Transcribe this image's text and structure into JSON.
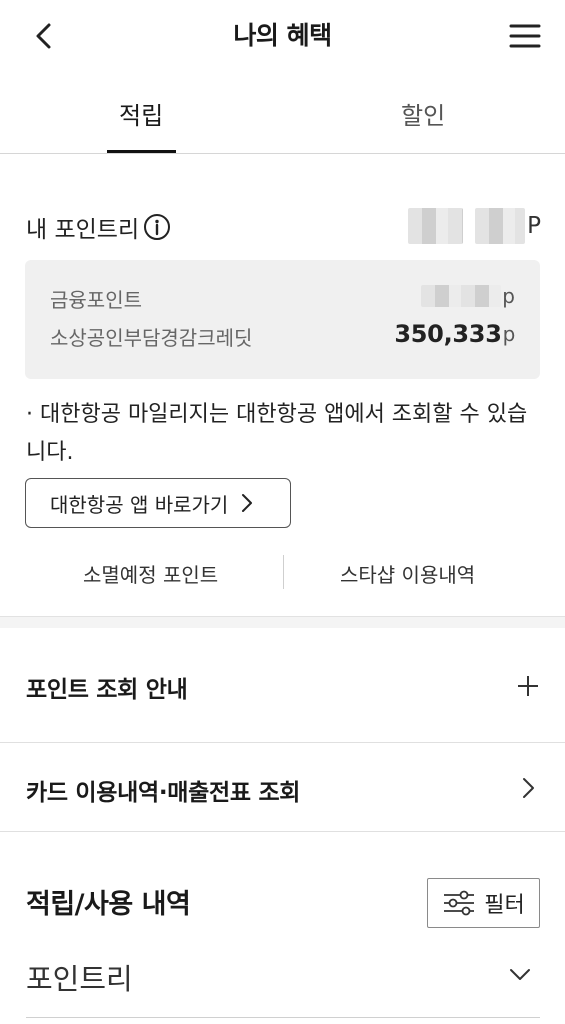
{
  "header": {
    "title": "나의 혜택"
  },
  "tabs": [
    {
      "label": "적립",
      "active": true
    },
    {
      "label": "할인",
      "active": false
    }
  ],
  "points": {
    "label": "내 포인트리",
    "unit": "P",
    "finance_label": "금융포인트",
    "finance_unit": "p",
    "credit_label": "소상공인부담경감크레딧",
    "credit_value": "350,333",
    "credit_unit": "p"
  },
  "notice": {
    "text": "· 대한항공 마일리지는 대한항공 앱에서 조회할 수 있습니다.",
    "button_label": "대한항공 앱 바로가기"
  },
  "links": {
    "expiring": "소멸예정 포인트",
    "starshop": "스타샵 이용내역"
  },
  "sections": {
    "inquiry_guide": "포인트 조회 안내",
    "card_usage": "카드 이용내역·매출전표 조회"
  },
  "history": {
    "title": "적립/사용 내역",
    "filter_label": "필터",
    "selected_type": "포인트리"
  },
  "icons": {
    "back": "chevron-left-icon",
    "menu": "hamburger-menu-icon",
    "info": "info-circle-icon",
    "expand": "plus-icon",
    "go": "chevron-right-icon",
    "filter": "sliders-icon",
    "dropdown": "chevron-down-icon"
  }
}
